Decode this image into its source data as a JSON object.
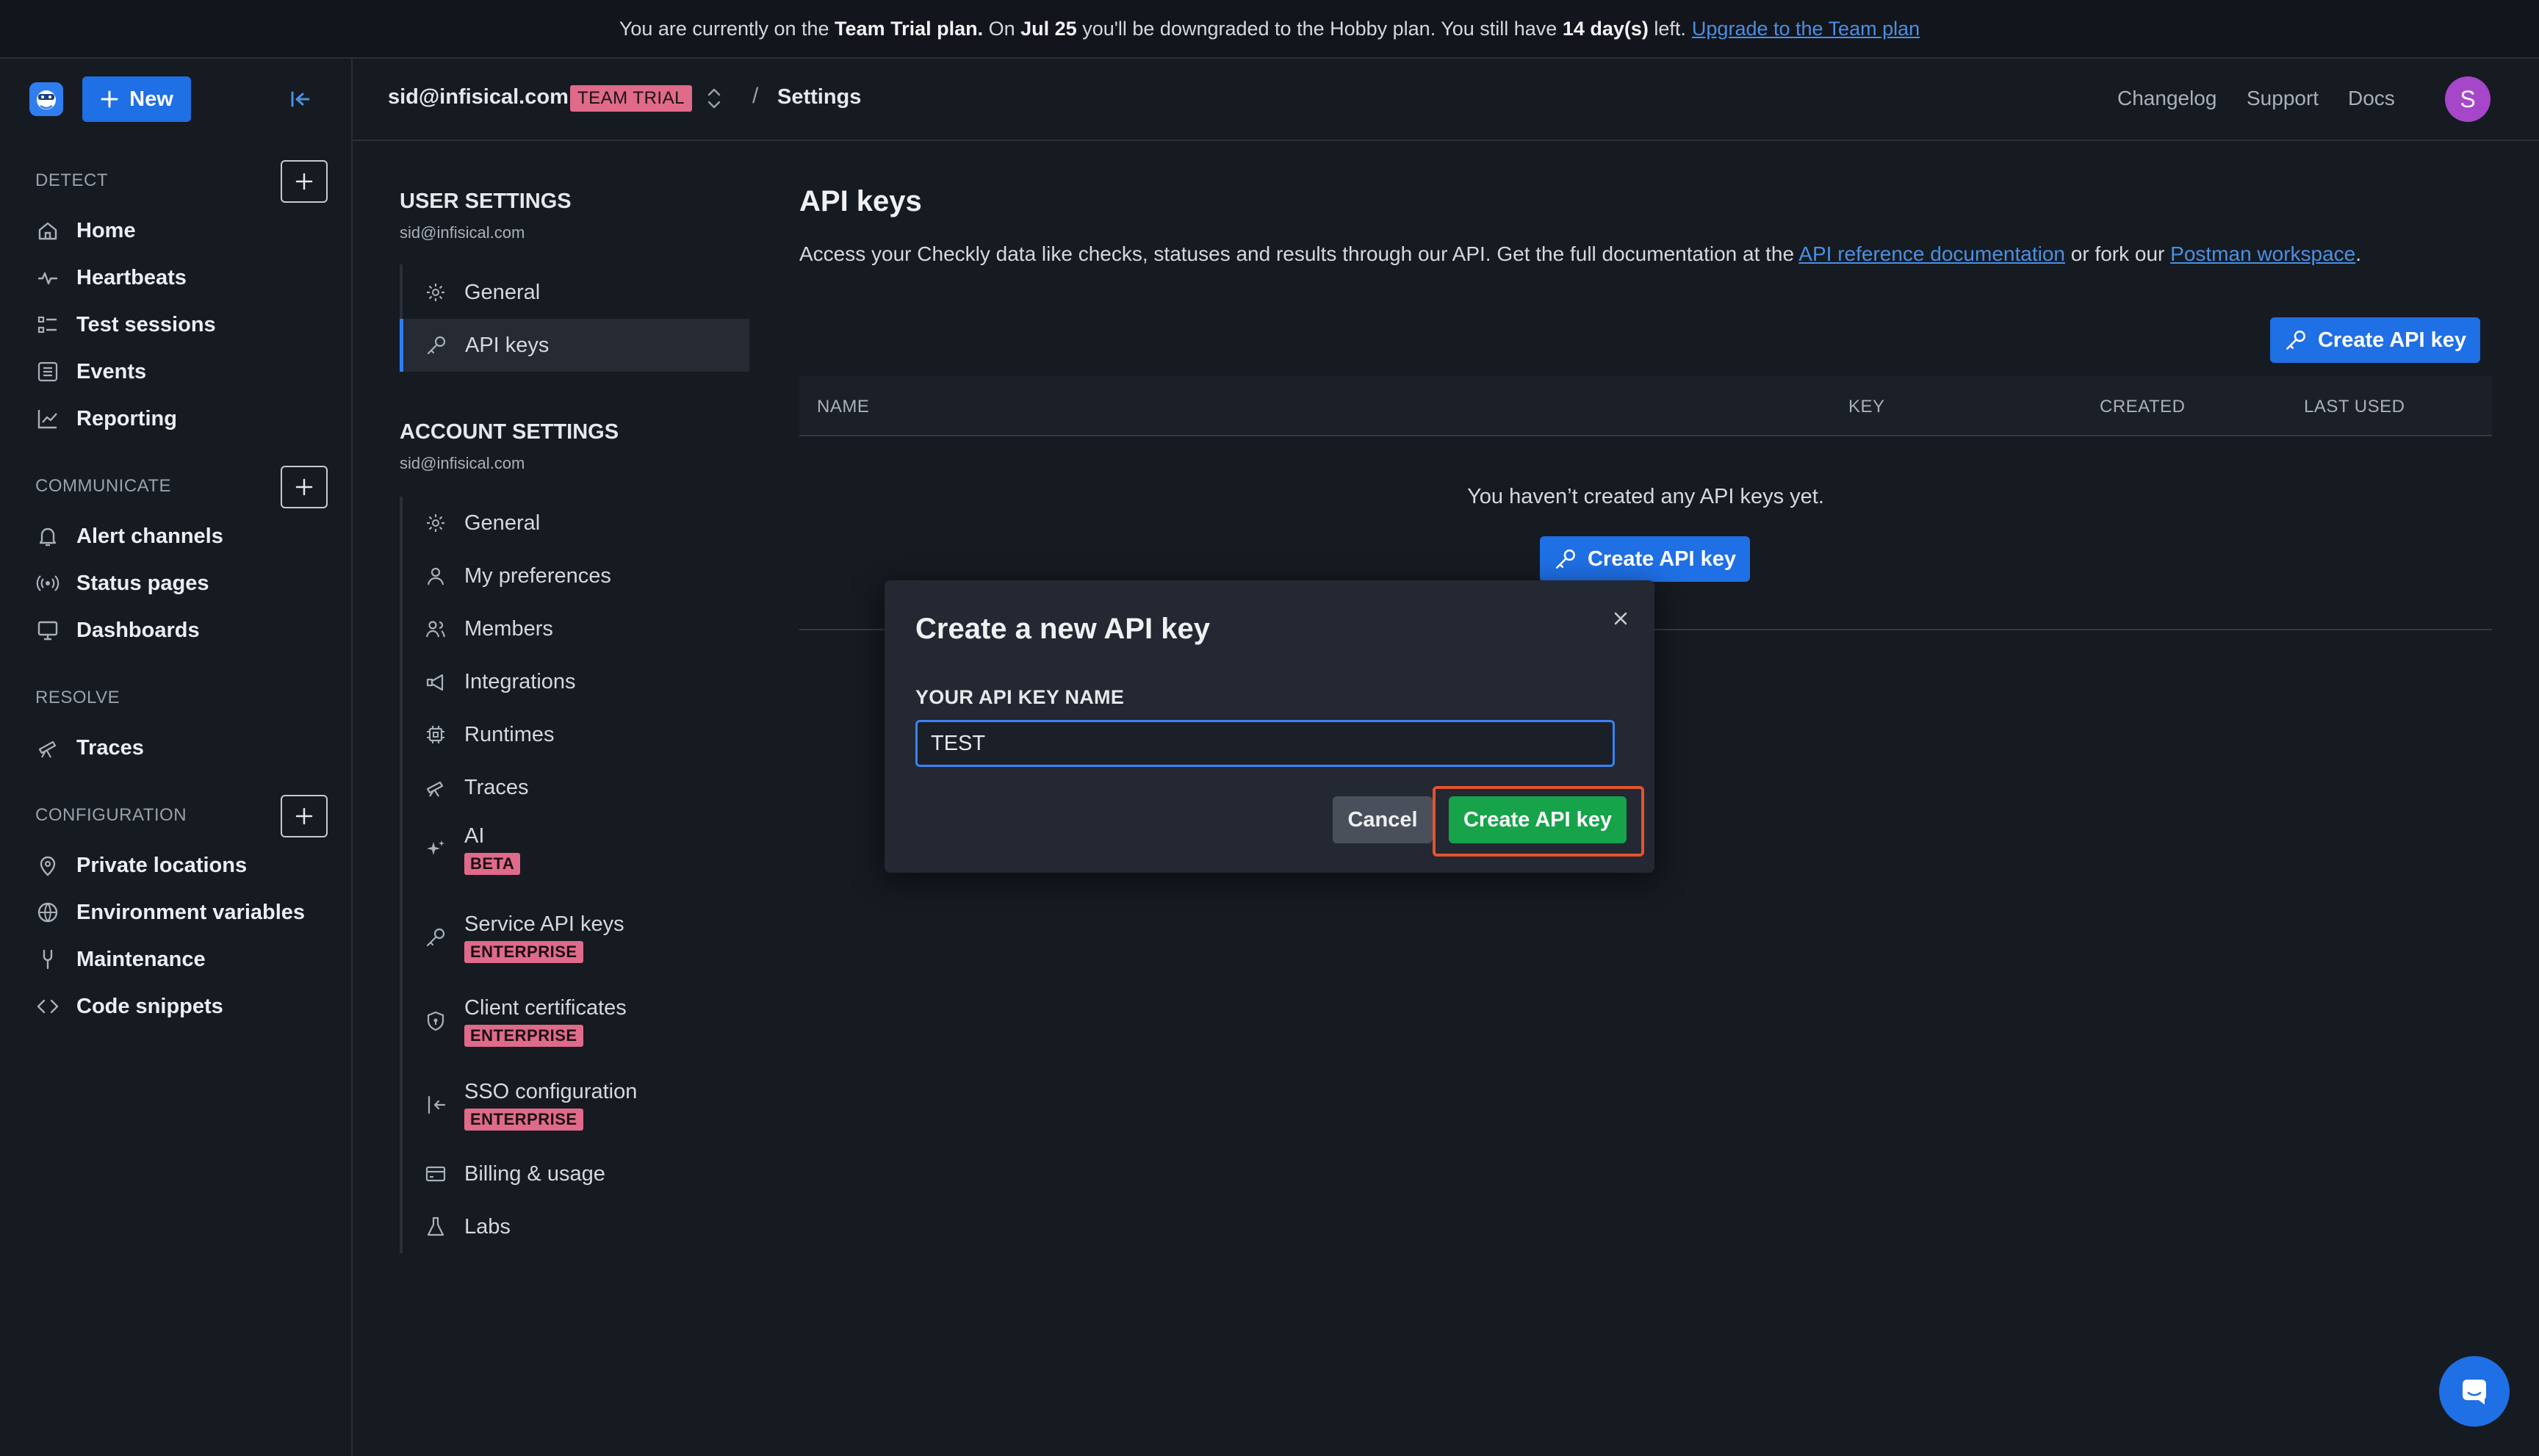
{
  "banner": {
    "part1": "You are currently on the ",
    "plan": "Team Trial plan.",
    "part2": " On ",
    "date": "Jul 25",
    "part3": " you'll be downgraded to the Hobby plan. You still have ",
    "days": "14 day(s)",
    "part4": " left.",
    "link": "Upgrade to the Team plan"
  },
  "sidebar": {
    "new_label": "New",
    "sections": {
      "detect": "DETECT",
      "communicate": "COMMUNICATE",
      "resolve": "RESOLVE",
      "configuration": "CONFIGURATION"
    },
    "items": {
      "home": "Home",
      "heartbeats": "Heartbeats",
      "test_sessions": "Test sessions",
      "events": "Events",
      "reporting": "Reporting",
      "alert_channels": "Alert channels",
      "status_pages": "Status pages",
      "dashboards": "Dashboards",
      "traces": "Traces",
      "private_locations": "Private locations",
      "environment_variables": "Environment variables",
      "maintenance": "Maintenance",
      "code_snippets": "Code snippets"
    }
  },
  "header": {
    "account": "sid@infisical.com",
    "badge": "TEAM TRIAL",
    "separator": "/",
    "page": "Settings",
    "links": {
      "changelog": "Changelog",
      "support": "Support",
      "docs": "Docs"
    },
    "avatar_initial": "S"
  },
  "settings_nav": {
    "user_title": "USER SETTINGS",
    "user_email": "sid@infisical.com",
    "user_items": {
      "general": "General",
      "api_keys": "API keys"
    },
    "account_title": "ACCOUNT SETTINGS",
    "account_email": "sid@infisical.com",
    "account_items": {
      "general": "General",
      "my_preferences": "My preferences",
      "members": "Members",
      "integrations": "Integrations",
      "runtimes": "Runtimes",
      "traces": "Traces",
      "ai": "AI",
      "ai_badge": "BETA",
      "service_api_keys": "Service API keys",
      "client_certificates": "Client certificates",
      "sso_configuration": "SSO configuration",
      "enterprise_badge": "ENTERPRISE",
      "billing_usage": "Billing & usage",
      "labs": "Labs"
    }
  },
  "main": {
    "title": "API keys",
    "desc_prefix": "Access your Checkly data like checks, statuses and results through our API. Get the full documentation at the ",
    "desc_link1": "API reference documentation",
    "desc_mid": " or fork our ",
    "desc_link2": "Postman workspace",
    "desc_suffix": ".",
    "create_button": "Create API key",
    "columns": {
      "name": "NAME",
      "key": "KEY",
      "created": "CREATED",
      "last_used": "LAST USED"
    },
    "empty_message": "You haven’t created any API keys yet.",
    "empty_create_button": "Create API key"
  },
  "modal": {
    "title": "Create a new API key",
    "field_label": "YOUR API KEY NAME",
    "field_value": "TEST",
    "cancel": "Cancel",
    "create": "Create API key"
  },
  "colors": {
    "accent_blue": "#1f6fe5",
    "success_green": "#16a34a",
    "badge_pink": "#e06a8a",
    "highlight_ring": "#e5532d",
    "avatar_purple": "#a646c9"
  }
}
